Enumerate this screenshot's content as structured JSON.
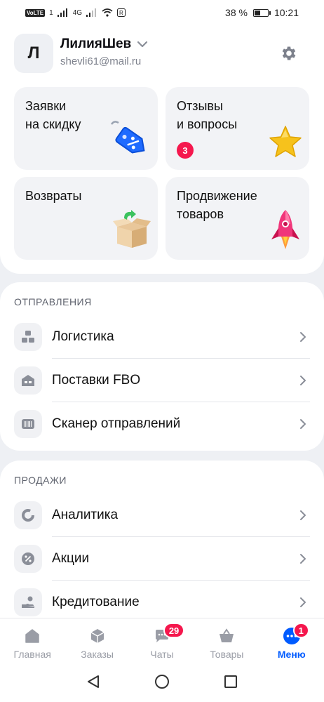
{
  "status_bar": {
    "network_chip": "VoLTE",
    "sim": "1",
    "signal_label": "4G",
    "battery_percent": "38 %",
    "battery_level": 0.38,
    "time": "10:21"
  },
  "profile": {
    "avatar_letter": "Л",
    "name": "ЛилияШев",
    "email": "shevli61@mail.ru"
  },
  "tiles": [
    {
      "label": "Заявки\nна скидку",
      "art": "discount-tag"
    },
    {
      "label": "Отзывы\nи вопросы",
      "badge": "3",
      "art": "star"
    },
    {
      "label": "Возвраты",
      "art": "return-box"
    },
    {
      "label": "Продвижение\nтоваров",
      "art": "rocket"
    }
  ],
  "sections": [
    {
      "title": "ОТПРАВЛЕНИЯ",
      "items": [
        {
          "label": "Логистика",
          "icon": "boxes-icon"
        },
        {
          "label": "Поставки FBO",
          "icon": "warehouse-icon"
        },
        {
          "label": "Сканер отправлений",
          "icon": "barcode-scanner-icon"
        }
      ]
    },
    {
      "title": "ПРОДАЖИ",
      "items": [
        {
          "label": "Аналитика",
          "icon": "donut-chart-icon"
        },
        {
          "label": "Акции",
          "icon": "percent-icon"
        },
        {
          "label": "Кредитование",
          "icon": "loan-hand-icon"
        }
      ]
    }
  ],
  "tabbar": {
    "tabs": [
      {
        "label": "Главная",
        "icon": "home-icon"
      },
      {
        "label": "Заказы",
        "icon": "package-icon"
      },
      {
        "label": "Чаты",
        "icon": "chat-icon",
        "badge": "29"
      },
      {
        "label": "Товары",
        "icon": "basket-icon"
      },
      {
        "label": "Меню",
        "icon": "menu-dots-icon",
        "badge": "1",
        "active": true
      }
    ]
  },
  "colors": {
    "accent": "#005bff",
    "badge": "#f5174d",
    "background": "#eef0f4"
  }
}
